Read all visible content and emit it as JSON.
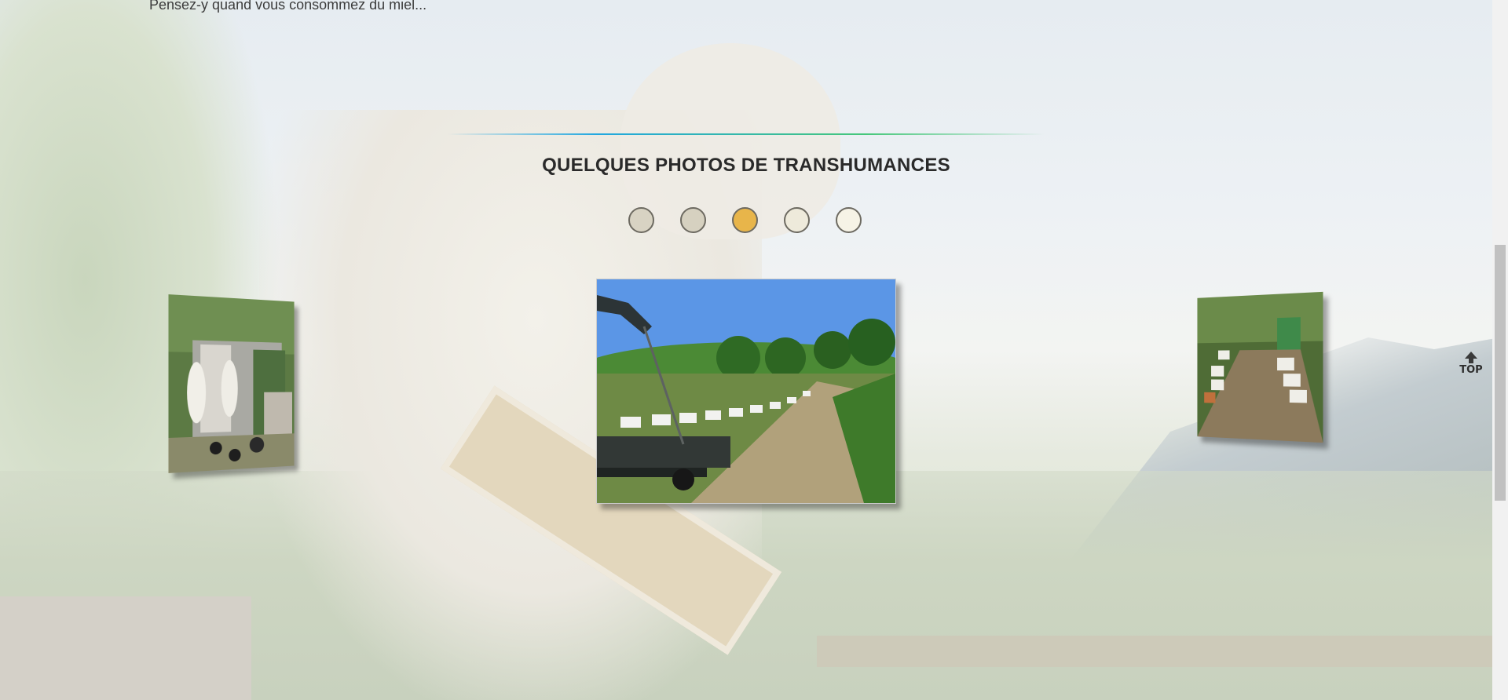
{
  "intro": {
    "text": "Pensez-y quand vous consommez du miel..."
  },
  "section": {
    "title": "QUELQUES PHOTOS DE TRANSHUMANCES"
  },
  "carousel": {
    "indicators": [
      {
        "label": "slide 1",
        "color": "#d8d3c3",
        "active": false
      },
      {
        "label": "slide 2",
        "color": "#d6d1c0",
        "active": false
      },
      {
        "label": "slide 3",
        "color": "#e8b54a",
        "active": true
      },
      {
        "label": "slide 4",
        "color": "#eeeadb",
        "active": false
      },
      {
        "label": "slide 5",
        "color": "#f6f3e6",
        "active": false
      }
    ],
    "photos": [
      {
        "position": "left",
        "subject": "beekeepers loading hives onto truck"
      },
      {
        "position": "center",
        "subject": "rows of beehives along a track with flatbed trailer"
      },
      {
        "position": "right",
        "subject": "beehives lined up on a truck bed under trees"
      }
    ]
  },
  "back_to_top": {
    "label": "TOP",
    "icon": "arrow-up-icon"
  },
  "colors": {
    "accent": "#e8b54a",
    "divider_start": "#21a7e0",
    "divider_end": "#46c77a",
    "title": "#2a2a2a"
  }
}
